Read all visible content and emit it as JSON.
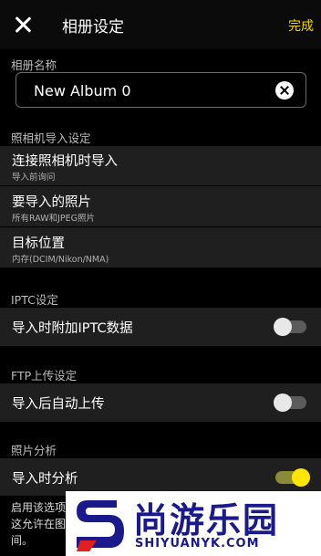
{
  "header": {
    "title": "相册设定",
    "done_label": "完成"
  },
  "album_name": {
    "section_label": "相册名称",
    "value": "New Album 0"
  },
  "camera_import": {
    "section_label": "照相机导入设定",
    "items": [
      {
        "title": "连接照相机时导入",
        "subtitle": "导入前询问"
      },
      {
        "title": "要导入的照片",
        "subtitle": "所有RAW和JPEG照片"
      },
      {
        "title": "目标位置",
        "subtitle": "内存(DCIM/Nikon/NMA)"
      }
    ]
  },
  "iptc": {
    "section_label": "IPTC设定",
    "item": {
      "title": "导入时附加IPTC数据",
      "enabled": false
    }
  },
  "ftp": {
    "section_label": "FTP上传设定",
    "item": {
      "title": "导入后自动上传",
      "enabled": false
    }
  },
  "analysis": {
    "section_label": "照片分析",
    "item": {
      "title": "导入时分析",
      "enabled": true
    }
  },
  "description": {
    "lines": [
      "启用该选项",
      "这允许在图",
      "间。"
    ]
  },
  "watermark": {
    "text": "尚游乐园",
    "url": "SHIYUANYK.COM",
    "color": "#1b1a8c"
  },
  "colors": {
    "accent": "#f5d800",
    "toggle_on": "#ffe600",
    "row_bg": "#1f1f1f"
  }
}
